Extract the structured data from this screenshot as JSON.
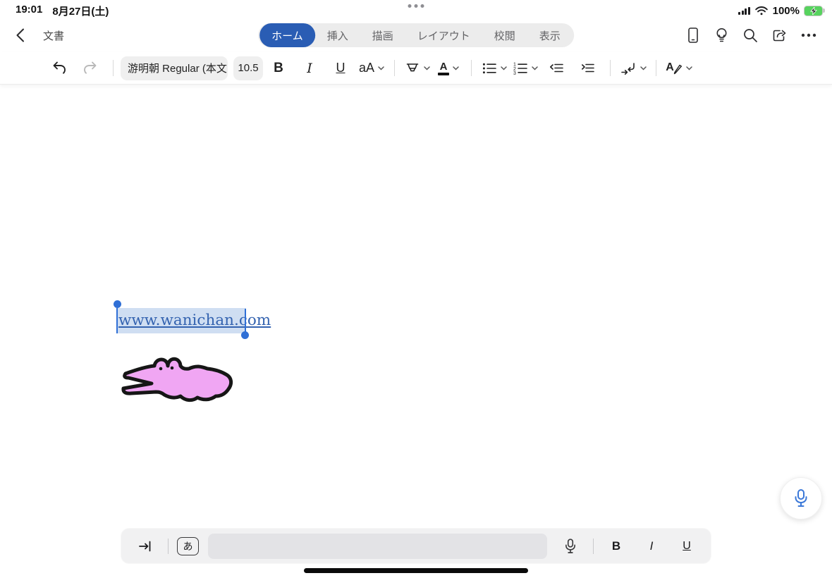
{
  "status_bar": {
    "time": "19:01",
    "date": "8月27日(土)",
    "battery_percent": "100%"
  },
  "nav": {
    "title": "文書",
    "tabs": [
      {
        "label": "ホーム",
        "active": true
      },
      {
        "label": "挿入",
        "active": false
      },
      {
        "label": "描画",
        "active": false
      },
      {
        "label": "レイアウト",
        "active": false
      },
      {
        "label": "校閲",
        "active": false
      },
      {
        "label": "表示",
        "active": false
      }
    ],
    "right_icons": [
      "mobile-view-icon",
      "lightbulb-icon",
      "search-icon",
      "share-icon",
      "more-ellipsis-icon"
    ]
  },
  "toolbar": {
    "font_name": "游明朝 Regular (本文",
    "font_size": "10.5",
    "bold": "B",
    "italic": "I",
    "underline": "U",
    "text_effects": "aA",
    "font_color_letter": "A",
    "styles_letter": "A",
    "icons": [
      "undo-icon",
      "redo-icon",
      "highlighter-icon",
      "font-color-icon",
      "bullet-list-icon",
      "numbered-list-icon",
      "outdent-icon",
      "indent-icon",
      "line-break-icon",
      "format-pen-icon"
    ]
  },
  "document": {
    "link_text": "www.wanichan.com"
  },
  "accessory_bar": {
    "ime_key": "あ",
    "bold": "B",
    "italic": "I",
    "underline": "U",
    "input_value": "",
    "input_placeholder": "",
    "icons": [
      "tab-key-icon",
      "mic-icon"
    ]
  },
  "colors": {
    "accent_blue": "#2a5db4",
    "selection_handle_blue": "#2f6fd6",
    "link_blue": "#3463b0",
    "selection_bg": "#cfdef2",
    "battery_green": "#57d35e",
    "doodle_pink": "#f0a6f3"
  }
}
